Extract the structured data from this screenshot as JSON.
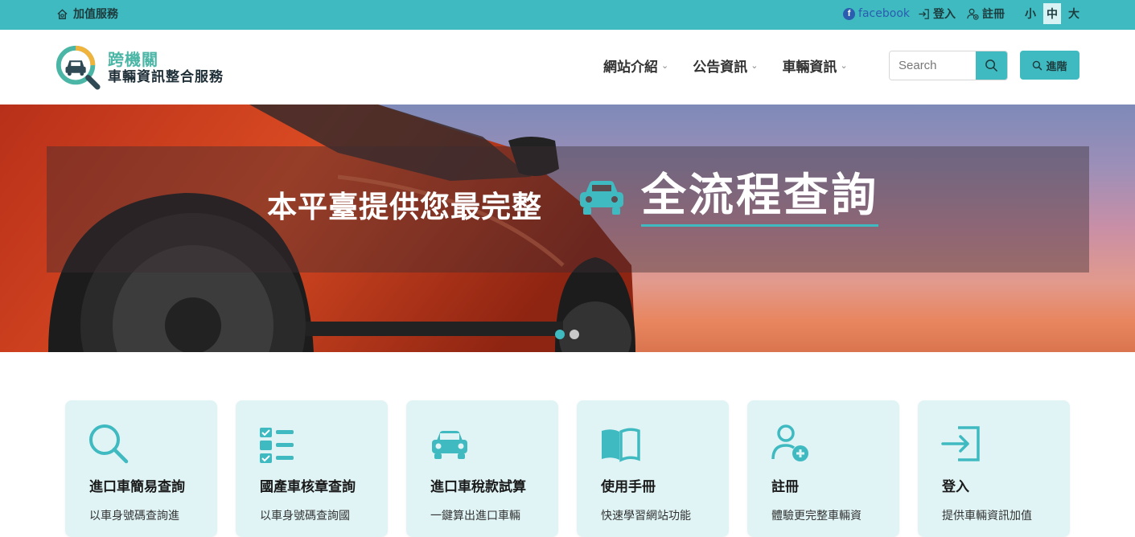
{
  "topbar": {
    "value_added": "加值服務",
    "facebook": "facebook",
    "login": "登入",
    "register": "註冊",
    "font_sizes": [
      "小",
      "中",
      "大"
    ],
    "active_font_size": "中"
  },
  "header": {
    "logo_line1": "跨機關",
    "logo_line2": "車輛資訊整合服務",
    "nav": [
      {
        "label": "網站介紹"
      },
      {
        "label": "公告資訊"
      },
      {
        "label": "車輛資訊"
      }
    ],
    "search_placeholder": "Search",
    "advanced_label": "進階"
  },
  "hero": {
    "lead": "本平臺提供您最完整",
    "highlight": "全流程查詢",
    "slide_count": 2,
    "active_slide": 1
  },
  "cards": [
    {
      "icon": "search-icon",
      "title": "進口車簡易查詢",
      "desc": "以車身號碼查詢進"
    },
    {
      "icon": "checklist-icon",
      "title": "國產車核章查詢",
      "desc": "以車身號碼查詢國"
    },
    {
      "icon": "car-icon",
      "title": "進口車稅款試算",
      "desc": "一鍵算出進口車輛"
    },
    {
      "icon": "book-icon",
      "title": "使用手冊",
      "desc": "快速學習網站功能"
    },
    {
      "icon": "user-add-icon",
      "title": "註冊",
      "desc": "體驗更完整車輛資"
    },
    {
      "icon": "login-icon",
      "title": "登入",
      "desc": "提供車輛資訊加值"
    }
  ],
  "colors": {
    "accent": "#3fbac1",
    "card_bg": "#e0f4f5",
    "logo_green": "#4bb6a6"
  }
}
